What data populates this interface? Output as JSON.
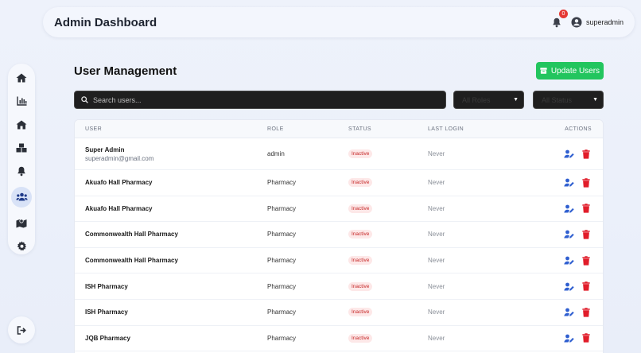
{
  "header": {
    "title": "Admin Dashboard",
    "notification_count": "0",
    "username": "superadmin"
  },
  "sidebar": {
    "items": [
      {
        "icon": "home-icon"
      },
      {
        "icon": "chart-icon"
      },
      {
        "icon": "building-icon"
      },
      {
        "icon": "boxes-icon"
      },
      {
        "icon": "bell-icon"
      },
      {
        "icon": "users-icon",
        "active": true
      },
      {
        "icon": "map-icon"
      },
      {
        "icon": "gear-icon"
      }
    ],
    "logout_icon": "logout-icon"
  },
  "main": {
    "title": "User Management",
    "update_button": "Update Users",
    "search_placeholder": "Search users...",
    "role_filter": "All Roles",
    "status_filter": "All Status"
  },
  "table": {
    "headers": {
      "user": "USER",
      "role": "ROLE",
      "status": "STATUS",
      "last_login": "LAST LOGIN",
      "actions": "ACTIONS"
    },
    "rows": [
      {
        "name": "Super Admin",
        "email": "superadmin@gmail.com",
        "role": "admin",
        "status": "Inactive",
        "last_login": "Never"
      },
      {
        "name": "Akuafo Hall Pharmacy",
        "email": "",
        "role": "Pharmacy",
        "status": "Inactive",
        "last_login": "Never"
      },
      {
        "name": "Akuafo Hall Pharmacy",
        "email": "",
        "role": "Pharmacy",
        "status": "Inactive",
        "last_login": "Never"
      },
      {
        "name": "Commonwealth Hall Pharmacy",
        "email": "",
        "role": "Pharmacy",
        "status": "Inactive",
        "last_login": "Never"
      },
      {
        "name": "Commonwealth Hall Pharmacy",
        "email": "",
        "role": "Pharmacy",
        "status": "Inactive",
        "last_login": "Never"
      },
      {
        "name": "ISH Pharmacy",
        "email": "",
        "role": "Pharmacy",
        "status": "Inactive",
        "last_login": "Never"
      },
      {
        "name": "ISH Pharmacy",
        "email": "",
        "role": "Pharmacy",
        "status": "Inactive",
        "last_login": "Never"
      },
      {
        "name": "JQB Pharmacy",
        "email": "",
        "role": "Pharmacy",
        "status": "Inactive",
        "last_login": "Never"
      }
    ]
  },
  "colors": {
    "accent_green": "#22c55e",
    "edit_blue": "#2f5fd0",
    "delete_red": "#e11d2a",
    "badge_red": "#e53935"
  }
}
